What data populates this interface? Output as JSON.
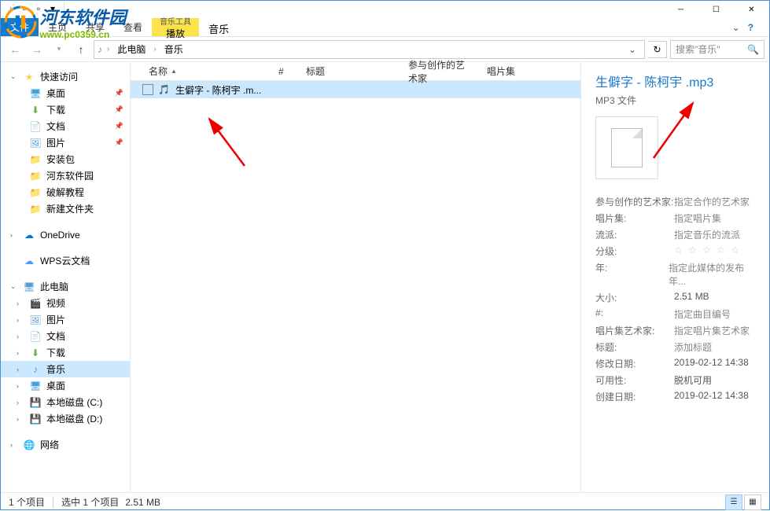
{
  "watermark": {
    "title": "河东软件园",
    "url": "www.pc0359.cn"
  },
  "ribbon": {
    "file": "文件",
    "tabs": [
      "主页",
      "共享",
      "查看"
    ],
    "context_group": "音乐工具",
    "context_tab": "播放",
    "title": "音乐"
  },
  "breadcrumb": {
    "items": [
      "此电脑",
      "音乐"
    ],
    "search_placeholder": "搜索\"音乐\""
  },
  "sidebar": {
    "quick_access": "快速访问",
    "qa_items": [
      {
        "icon": "desktop",
        "label": "桌面",
        "pinned": true
      },
      {
        "icon": "download",
        "label": "下载",
        "pinned": true
      },
      {
        "icon": "document",
        "label": "文档",
        "pinned": true
      },
      {
        "icon": "picture",
        "label": "图片",
        "pinned": true
      },
      {
        "icon": "folder",
        "label": "安装包"
      },
      {
        "icon": "folder",
        "label": "河东软件园"
      },
      {
        "icon": "folder",
        "label": "破解教程"
      },
      {
        "icon": "folder",
        "label": "新建文件夹"
      }
    ],
    "onedrive": "OneDrive",
    "wps": "WPS云文档",
    "this_pc": "此电脑",
    "pc_items": [
      {
        "icon": "video",
        "label": "视频"
      },
      {
        "icon": "picture",
        "label": "图片"
      },
      {
        "icon": "document",
        "label": "文档"
      },
      {
        "icon": "download",
        "label": "下载"
      },
      {
        "icon": "music",
        "label": "音乐",
        "active": true
      },
      {
        "icon": "desktop",
        "label": "桌面"
      },
      {
        "icon": "drive",
        "label": "本地磁盘 (C:)"
      },
      {
        "icon": "drive",
        "label": "本地磁盘 (D:)"
      }
    ],
    "network": "网络"
  },
  "columns": {
    "name": "名称",
    "num": "#",
    "title": "标题",
    "artist": "参与创作的艺术家",
    "album": "唱片集"
  },
  "files": [
    {
      "name": "生僻字 - 陈柯宇 .m..."
    }
  ],
  "details": {
    "title": "生僻字 - 陈柯宇 .mp3",
    "type": "MP3 文件",
    "props": [
      {
        "key": "参与创作的艺术家:",
        "val": "指定合作的艺术家",
        "placeholder": true
      },
      {
        "key": "唱片集:",
        "val": "指定唱片集",
        "placeholder": true
      },
      {
        "key": "流派:",
        "val": "指定音乐的流派",
        "placeholder": true
      },
      {
        "key": "分级:",
        "val": "stars"
      },
      {
        "key": "年:",
        "val": "指定此媒体的发布年...",
        "placeholder": true
      },
      {
        "key": "大小:",
        "val": "2.51 MB"
      },
      {
        "key": "#:",
        "val": "指定曲目编号",
        "placeholder": true
      },
      {
        "key": "唱片集艺术家:",
        "val": "指定唱片集艺术家",
        "placeholder": true
      },
      {
        "key": "标题:",
        "val": "添加标题",
        "placeholder": true
      },
      {
        "key": "修改日期:",
        "val": "2019-02-12 14:38"
      },
      {
        "key": "可用性:",
        "val": "脱机可用"
      },
      {
        "key": "创建日期:",
        "val": "2019-02-12 14:38"
      }
    ]
  },
  "statusbar": {
    "count": "1 个项目",
    "selected": "选中 1 个项目",
    "size": "2.51 MB"
  }
}
